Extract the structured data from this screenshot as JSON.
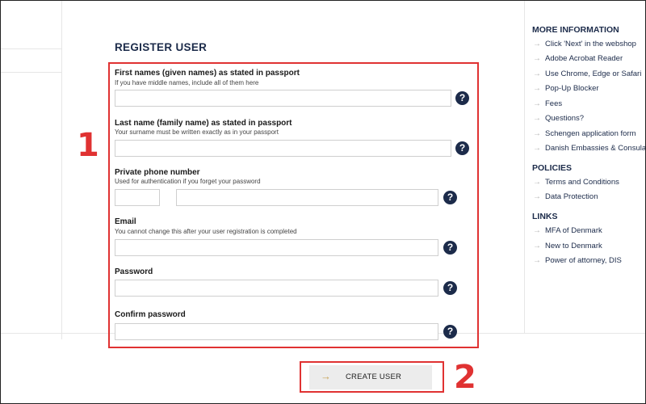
{
  "form": {
    "title": "REGISTER USER",
    "fields": [
      {
        "label": "First names (given names) as stated in passport",
        "hint": "If you have middle names, include all of them here",
        "value": ""
      },
      {
        "label": "Last name (family name) as stated in passport",
        "hint": "Your surname must be written exactly as in your passport",
        "value": ""
      },
      {
        "label": "Private phone number",
        "hint": "Used for authentication if you forget your password",
        "value": ""
      },
      {
        "label": "Email",
        "hint": "You cannot change this after your user registration is completed",
        "value": ""
      },
      {
        "label": "Password",
        "value": ""
      },
      {
        "label": "Confirm password",
        "value": ""
      }
    ],
    "help_symbol": "?",
    "create_button": "CREATE USER",
    "arrow_symbol": "→"
  },
  "annotations": {
    "step1": "1",
    "step2": "2",
    "highlight_color": "#e03232"
  },
  "sidebar": {
    "more_info": {
      "title": "MORE INFORMATION",
      "items": [
        "Click 'Next' in the webshop",
        "Adobe Acrobat Reader",
        "Use Chrome, Edge or Safari",
        "Pop-Up Blocker",
        "Fees",
        "Questions?",
        "Schengen application form",
        "Danish Embassies & Consulates"
      ]
    },
    "policies": {
      "title": "POLICIES",
      "items": [
        "Terms and Conditions",
        "Data Protection"
      ]
    },
    "links": {
      "title": "LINKS",
      "items": [
        "MFA of Denmark",
        "New to Denmark",
        "Power of attorney, DIS"
      ]
    },
    "arrow_symbol": "→"
  },
  "colors": {
    "navy": "#1c2b4a",
    "accent_arrow": "#c9a45a"
  }
}
